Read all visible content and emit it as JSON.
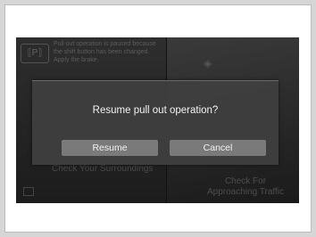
{
  "background_screen": {
    "notice_lines": [
      "Pull out operation is paused because",
      "the shift button has been changed.",
      "Apply the brake."
    ],
    "check_surroundings": "Check Your Surroundings",
    "check_traffic_lines": [
      "Check For",
      "Approaching Traffic"
    ]
  },
  "dialog": {
    "message": "Resume pull out operation?",
    "resume_label": "Resume",
    "cancel_label": "Cancel"
  },
  "colors": {
    "page_background": "#d6d6d6",
    "screen_background": "#202020",
    "dialog_background": "#3e3e3e",
    "button_background": "#7a7a7a",
    "text_primary": "#f2f2f2"
  },
  "icons": [
    "parking-sensor-icon",
    "camera-view-icon"
  ]
}
